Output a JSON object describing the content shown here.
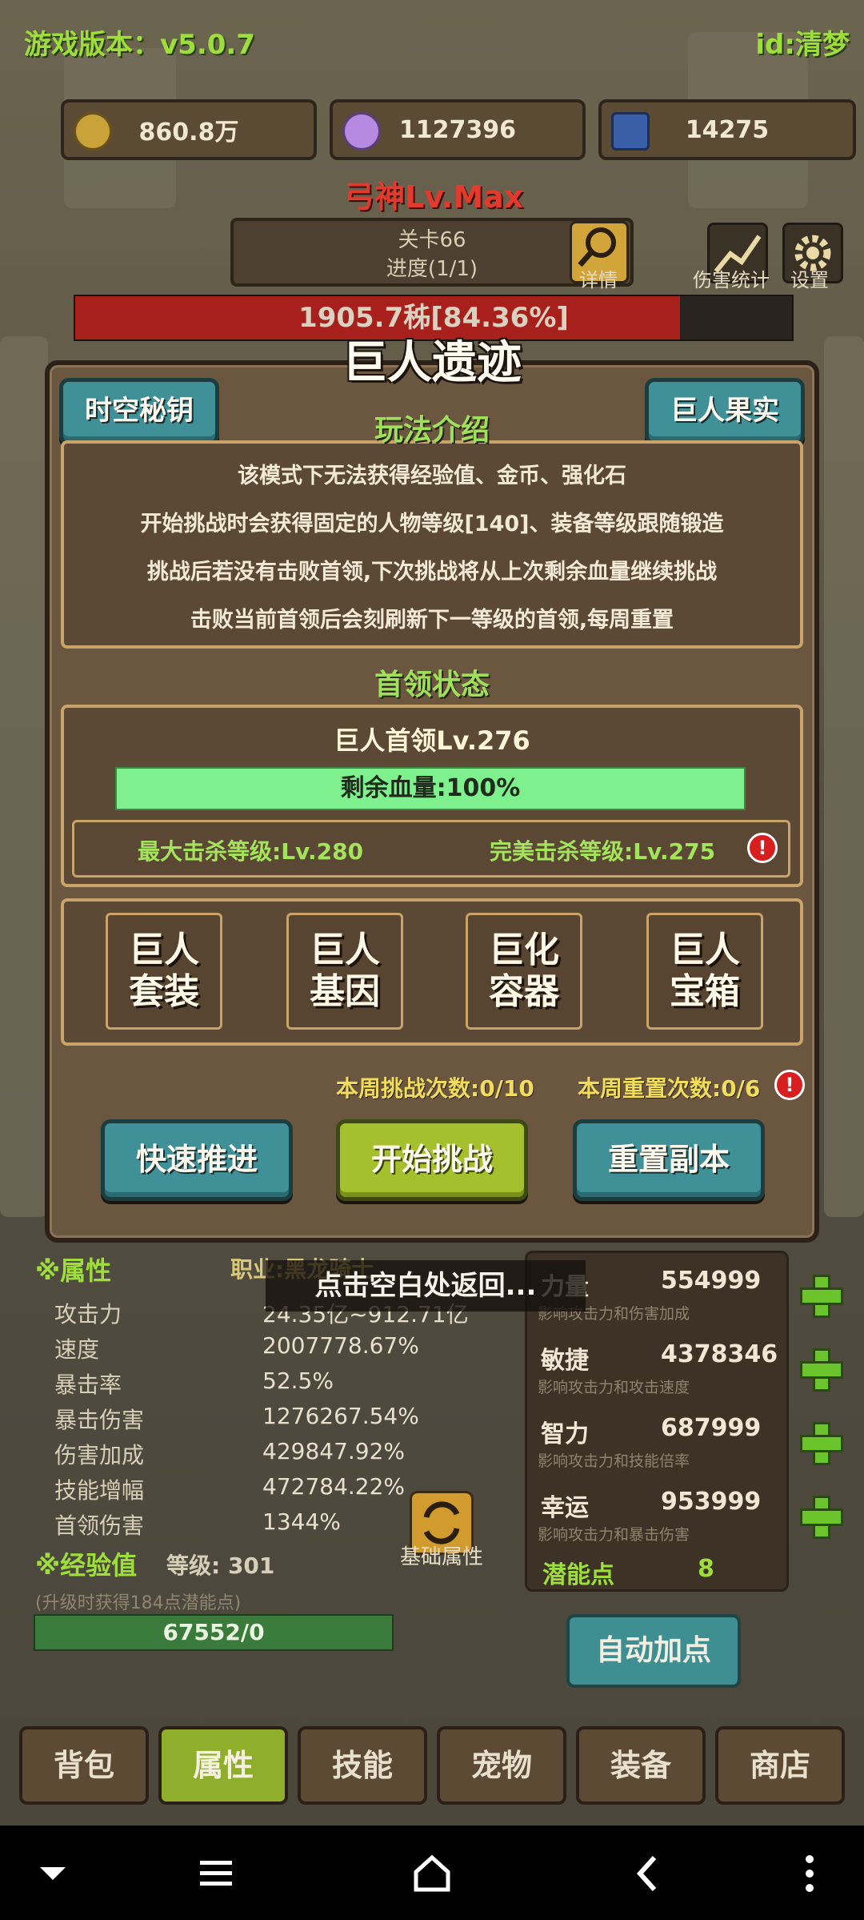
{
  "header": {
    "version": "游戏版本：v5.0.7",
    "user_id": "id:清梦"
  },
  "resources": [
    {
      "icon": "coin-icon",
      "value": "860.8万"
    },
    {
      "icon": "crystal-lotus-icon",
      "value": "1127396"
    },
    {
      "icon": "blue-card-icon",
      "value": "14275"
    }
  ],
  "player_title": "弓神Lv.Max",
  "stage": {
    "name": "关卡66",
    "progress": "进度(1/1)",
    "detail_label": "详情"
  },
  "tools": {
    "damage_stats": "伤害统计",
    "settings": "设置"
  },
  "boss_bar": {
    "text": "1905.7秭[84.36%]",
    "fraction": 0.8436
  },
  "modal": {
    "title": "巨人遗迹",
    "left_button": "时空秘钥",
    "right_button": "巨人果实",
    "rules_heading": "玩法介绍",
    "rules": [
      "该模式下无法获得经验值、金币、强化石",
      "开始挑战时会获得固定的人物等级[140]、装备等级跟随锻造",
      "挑战后若没有击败首领,下次挑战将从上次剩余血量继续挑战",
      "击败当前首领后会刻刷新下一等级的首领,每周重置"
    ],
    "boss_heading": "首领状态",
    "boss_name": "巨人首领Lv.276",
    "boss_hp": "剩余血量:100%",
    "boss_hp_fraction": 1.0,
    "max_kill": "最大击杀等级:Lv.280",
    "perfect_kill": "完美击杀等级:Lv.275",
    "items": [
      {
        "line1": "巨人",
        "line2": "套装"
      },
      {
        "line1": "巨人",
        "line2": "基因"
      },
      {
        "line1": "巨化",
        "line2": "容器"
      },
      {
        "line1": "巨人",
        "line2": "宝箱"
      }
    ],
    "weekly_challenges": "本周挑战次数:0/10",
    "weekly_resets": "本周重置次数:0/6",
    "buttons": {
      "fast": "快速推进",
      "start": "开始挑战",
      "reset": "重置副本"
    },
    "close_hint": "点击空白处返回..."
  },
  "attributes": {
    "heading": "※属性",
    "job": "职业:黑龙骑士",
    "stats": [
      {
        "label": "攻击力",
        "value": "24.35亿~912.71亿"
      },
      {
        "label": "速度",
        "value": "2007778.67%"
      },
      {
        "label": "暴击率",
        "value": "52.5%"
      },
      {
        "label": "暴击伤害",
        "value": "1276267.54%"
      },
      {
        "label": "伤害加成",
        "value": "429847.92%"
      },
      {
        "label": "技能增幅",
        "value": "472784.22%"
      },
      {
        "label": "首领伤害",
        "value": "1344%"
      }
    ],
    "base_attr_label": "基础属性",
    "core": [
      {
        "label": "力量",
        "value": "554999",
        "desc": "影响攻击力和伤害加成"
      },
      {
        "label": "敏捷",
        "value": "4378346",
        "desc": "影响攻击力和攻击速度"
      },
      {
        "label": "智力",
        "value": "687999",
        "desc": "影响攻击力和技能倍率"
      },
      {
        "label": "幸运",
        "value": "953999",
        "desc": "影响攻击力和暴击伤害"
      }
    ],
    "potential_label": "潜能点",
    "potential_value": "8",
    "auto_add": "自动加点"
  },
  "experience": {
    "heading": "※经验值",
    "level": "等级: 301",
    "note": "(升级时获得184点潜能点)",
    "bar": "67552/0"
  },
  "tabs": [
    "背包",
    "属性",
    "技能",
    "宠物",
    "装备",
    "商店"
  ],
  "active_tab": "属性",
  "colors": {
    "accent_green": "#9ede3a",
    "button_teal": "#3f9097",
    "button_green": "#a6bf2c",
    "hp_green": "#7ef08e",
    "boss_red": "#a8201c"
  }
}
